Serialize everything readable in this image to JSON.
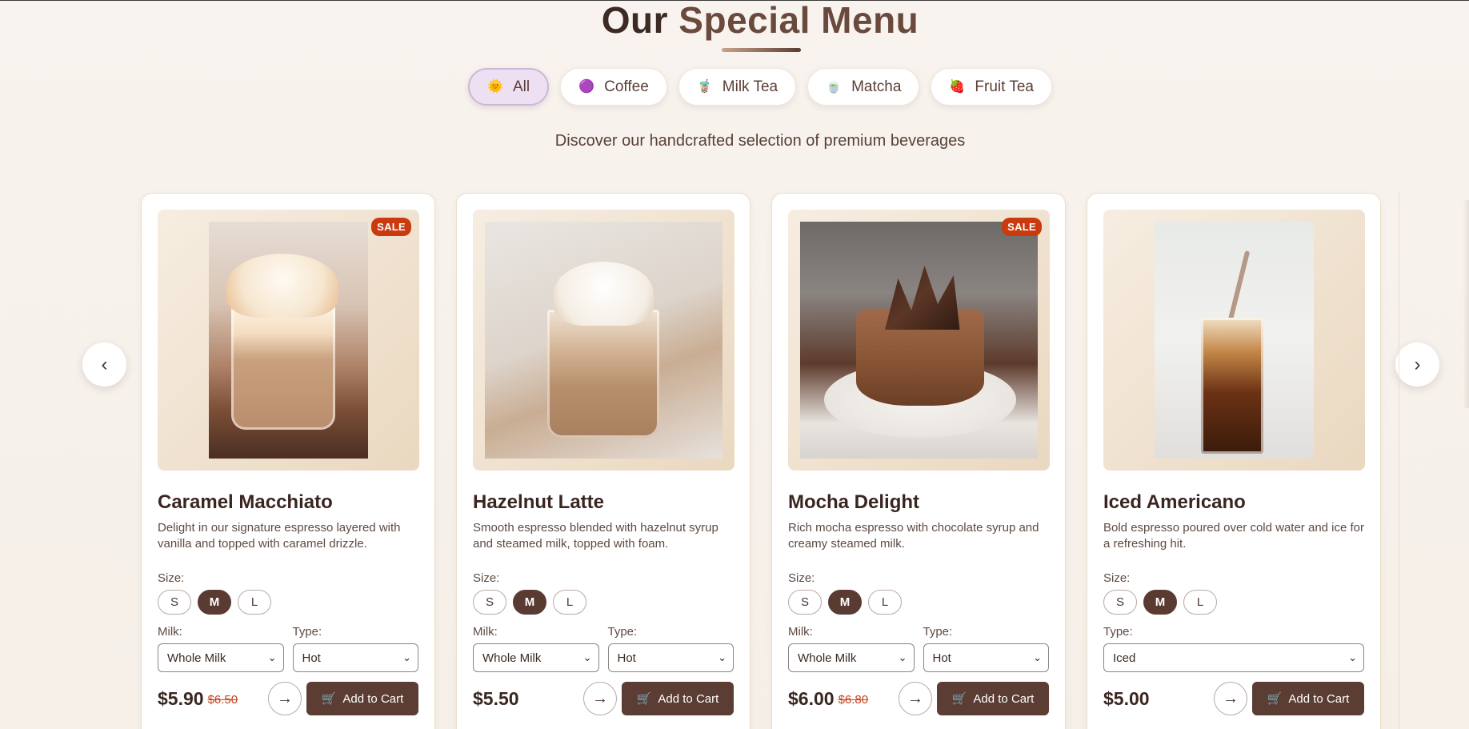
{
  "header": {
    "title_part1": "Our",
    "title_part2": "Special Menu",
    "subtitle": "Discover our handcrafted selection of premium beverages"
  },
  "categories": [
    {
      "label": "All",
      "icon": "sun-icon",
      "glyph": "🌞",
      "active": true
    },
    {
      "label": "Coffee",
      "icon": "coffee-icon",
      "glyph": "🟣",
      "active": false
    },
    {
      "label": "Milk Tea",
      "icon": "bubble-tea-icon",
      "glyph": "🧋",
      "active": false
    },
    {
      "label": "Matcha",
      "icon": "tea-icon",
      "glyph": "🍵",
      "active": false
    },
    {
      "label": "Fruit Tea",
      "icon": "strawberry-icon",
      "glyph": "🍓",
      "active": false
    }
  ],
  "navigation": {
    "prev_glyph": "‹",
    "next_glyph": "›"
  },
  "labels": {
    "size": "Size:",
    "milk": "Milk:",
    "type": "Type:",
    "add_to_cart": "Add to Cart",
    "sale": "SALE",
    "arrow_glyph": "→",
    "cart_glyph": "🛒",
    "chevron_glyph": "⌄"
  },
  "sizes": [
    "S",
    "M",
    "L"
  ],
  "products": [
    {
      "name": "Caramel Macchiato",
      "description": "Delight in our signature espresso layered with vanilla and topped with caramel drizzle.",
      "price": "$5.90",
      "old_price": "$6.50",
      "sale": true,
      "selected_size": "M",
      "milk": "Whole Milk",
      "type": "Hot"
    },
    {
      "name": "Hazelnut Latte",
      "description": "Smooth espresso blended with hazelnut syrup and steamed milk, topped with foam.",
      "price": "$5.50",
      "old_price": "",
      "sale": false,
      "selected_size": "M",
      "milk": "Whole Milk",
      "type": "Hot"
    },
    {
      "name": "Mocha Delight",
      "description": "Rich mocha espresso with chocolate syrup and creamy steamed milk.",
      "price": "$6.00",
      "old_price": "$6.80",
      "sale": true,
      "selected_size": "M",
      "milk": "Whole Milk",
      "type": "Hot"
    },
    {
      "name": "Iced Americano",
      "description": "Bold espresso poured over cold water and ice for a refreshing hit.",
      "price": "$5.00",
      "old_price": "",
      "sale": false,
      "selected_size": "M",
      "milk": null,
      "type": "Iced"
    }
  ],
  "colors": {
    "brand_dark": "#5b3d33",
    "title_accent": "#6b4a3e",
    "sale_red": "#c93a0e",
    "active_chip_bg": "#ece0f2",
    "background": "#f8f3ee"
  }
}
